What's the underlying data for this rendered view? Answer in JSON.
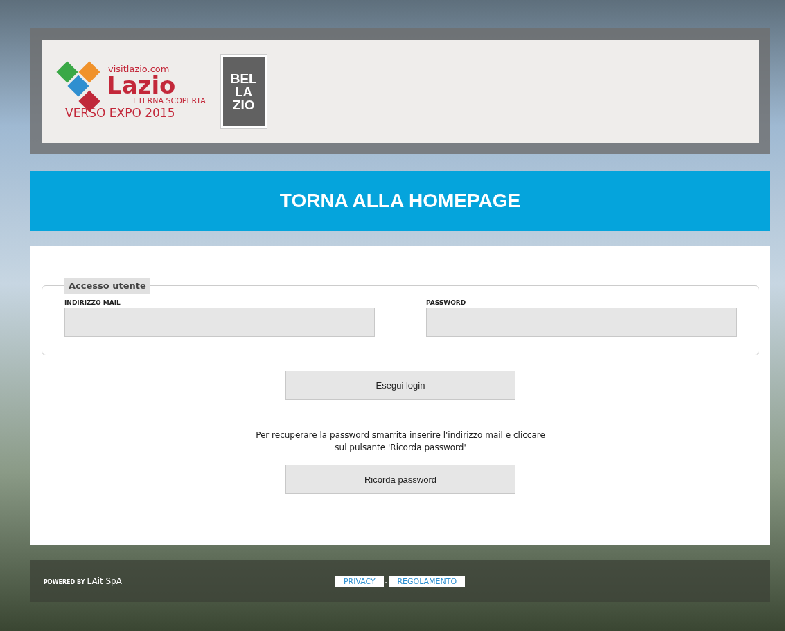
{
  "header": {
    "logo": {
      "site": "visitlazio.com",
      "name": "Lazio",
      "tagline": "ETERNA SCOPERTA",
      "event": "VERSO EXPO 2015"
    },
    "badge": [
      "BEL",
      "LA",
      "ZIO"
    ]
  },
  "home_link": "TORNA ALLA HOMEPAGE",
  "login": {
    "legend": "Accesso utente",
    "fields": [
      {
        "label": "INDIRIZZO MAIL"
      },
      {
        "label": "PASSWORD"
      }
    ],
    "submit": "Esegui login"
  },
  "recovery": {
    "note": "Per recuperare la password smarrita inserire l'indirizzo mail e cliccare sul pulsante 'Ricorda password'",
    "button": "Ricorda password"
  },
  "footer": {
    "powered_by": "POWERED BY",
    "company": "LAit SpA",
    "links": [
      "PRIVACY",
      "REGOLAMENTO"
    ],
    "separator": "-"
  }
}
